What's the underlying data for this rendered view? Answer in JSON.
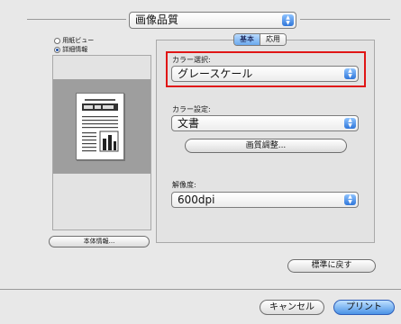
{
  "top_popup": {
    "value": "画像品質"
  },
  "view_options": {
    "items": [
      {
        "label": "用紙ビュー",
        "selected": false
      },
      {
        "label": "詳細情報",
        "selected": true
      }
    ]
  },
  "tabs": {
    "basic": "基本",
    "advanced": "応用"
  },
  "color_select": {
    "label": "カラー選択:",
    "value": "グレースケール"
  },
  "color_settings": {
    "label": "カラー設定:",
    "value": "文書"
  },
  "image_adjust_button": "画質調整...",
  "resolution": {
    "label": "解像度:",
    "value": "600dpi"
  },
  "printer_info_button": "本体情報...",
  "restore_defaults_button": "標準に戻す",
  "cancel_button": "キャンセル",
  "print_button": "プリント",
  "colors": {
    "highlight_border": "#e01616",
    "accent": "#3b86e0"
  }
}
